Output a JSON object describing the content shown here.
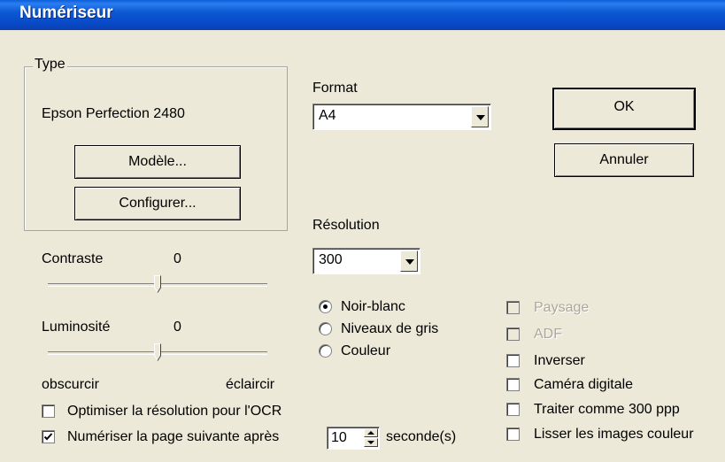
{
  "window": {
    "title": "Numériseur"
  },
  "type_group": {
    "legend": "Type",
    "device_name": "Epson Perfection 2480",
    "model_button": "Modèle...",
    "configure_button": "Configurer..."
  },
  "format": {
    "label": "Format",
    "value": "A4"
  },
  "resolution": {
    "label": "Résolution",
    "value": "300"
  },
  "contrast": {
    "label": "Contraste",
    "value": "0"
  },
  "brightness": {
    "label": "Luminosité",
    "value": "0",
    "min_label": "obscurcir",
    "max_label": "éclaircir"
  },
  "sliders": {
    "contrast_level": 0.5,
    "brightness_level": 0.5
  },
  "color_mode": {
    "options": [
      "Noir-blanc",
      "Niveaux de gris",
      "Couleur"
    ],
    "selected": "Noir-blanc"
  },
  "options": {
    "paysage": {
      "label": "Paysage",
      "checked": false,
      "enabled": false
    },
    "adf": {
      "label": "ADF",
      "checked": false,
      "enabled": false
    },
    "inverser": {
      "label": "Inverser",
      "checked": false,
      "enabled": true
    },
    "camera": {
      "label": "Caméra digitale",
      "checked": false,
      "enabled": true
    },
    "traiter": {
      "label": "Traiter comme 300 ppp",
      "checked": false,
      "enabled": true
    },
    "lisser": {
      "label": "Lisser les images couleur",
      "checked": false,
      "enabled": true
    }
  },
  "ocr": {
    "label": "Optimiser la résolution pour l'OCR",
    "checked": false
  },
  "next_page": {
    "label": "Numériser la page suivante après",
    "checked": true,
    "seconds": "10",
    "unit": "seconde(s)"
  },
  "buttons": {
    "ok": "OK",
    "cancel": "Annuler"
  }
}
